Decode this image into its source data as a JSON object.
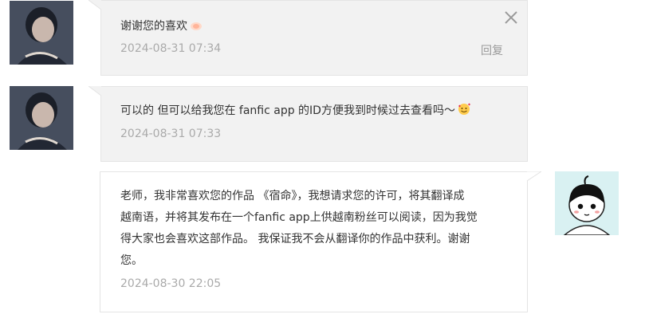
{
  "messages": [
    {
      "text": "谢谢您的喜欢",
      "emoji": "bow-emoji",
      "time": "2024-08-31 07:34",
      "reply_label": "回复"
    },
    {
      "text": "可以的 但可以给我您在 fanfic app 的ID方便我到时候过去查看吗～",
      "emoji": "smiling-face-with-hearts-emoji",
      "time": "2024-08-31 07:33"
    },
    {
      "lines": [
        "老师，我非常喜欢您的作品 《宿命》，我想请求您的许可，将其翻译成",
        "越南语，并将其发布在一个fanfic app上供越南粉丝可以阅读，因为我觉",
        "得大家也会喜欢这部作品。 我保证我不会从翻译你的作品中获利。谢谢",
        "您。"
      ],
      "time": "2024-08-30 22:05"
    }
  ],
  "colors": {
    "bubble_gray": "#f2f2f2",
    "bubble_white": "#ffffff",
    "border": "#e4e4e4",
    "text": "#333333",
    "time": "#aaaaaa"
  },
  "icons": {
    "close": "close-icon"
  }
}
